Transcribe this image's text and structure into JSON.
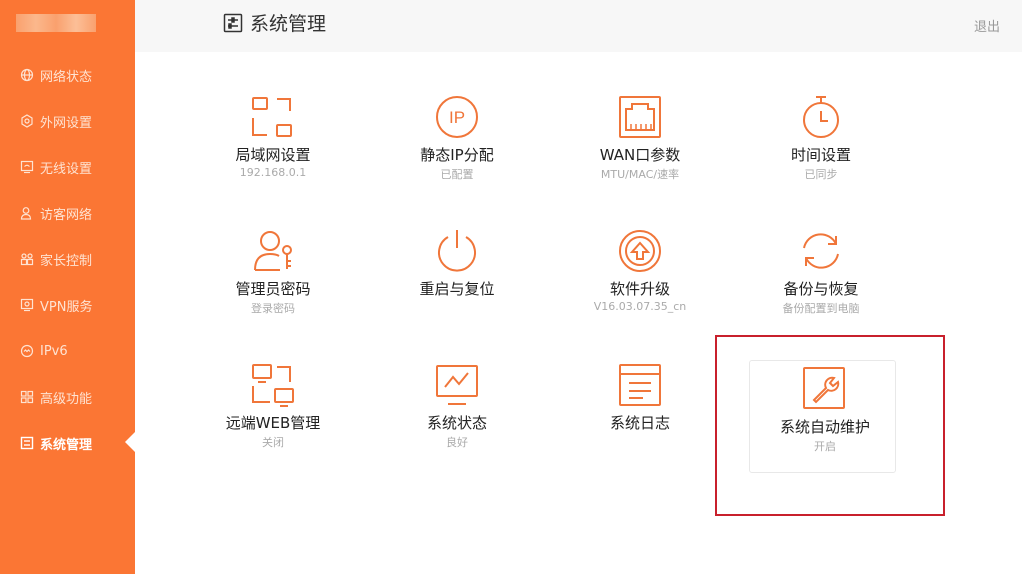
{
  "sidebar": {
    "items": [
      {
        "label": "网络状态",
        "icon": "globe-icon"
      },
      {
        "label": "外网设置",
        "icon": "gear-icon"
      },
      {
        "label": "无线设置",
        "icon": "wifi-icon"
      },
      {
        "label": "访客网络",
        "icon": "guest-icon"
      },
      {
        "label": "家长控制",
        "icon": "family-icon"
      },
      {
        "label": "VPN服务",
        "icon": "vpn-icon"
      },
      {
        "label": "IPv6",
        "icon": "ipv6-icon"
      },
      {
        "label": "高级功能",
        "icon": "grid-icon"
      },
      {
        "label": "系统管理",
        "icon": "system-icon",
        "active": true
      }
    ]
  },
  "header": {
    "title": "系统管理",
    "logout_label": "退出"
  },
  "tiles": [
    {
      "label": "局域网设置",
      "sub": "192.168.0.1",
      "icon": "lan-icon"
    },
    {
      "label": "静态IP分配",
      "sub": "已配置",
      "icon": "ip-icon",
      "icon_text": "IP"
    },
    {
      "label": "WAN口参数",
      "sub": "MTU/MAC/速率",
      "icon": "port-icon"
    },
    {
      "label": "时间设置",
      "sub": "已同步",
      "icon": "clock-icon"
    },
    {
      "label": "管理员密码",
      "sub": "登录密码",
      "icon": "admin-key-icon"
    },
    {
      "label": "重启与复位",
      "sub": "",
      "icon": "power-icon"
    },
    {
      "label": "软件升级",
      "sub": "V16.03.07.35_cn",
      "icon": "upgrade-icon"
    },
    {
      "label": "备份与恢复",
      "sub": "备份配置到电脑",
      "icon": "sync-icon"
    },
    {
      "label": "远端WEB管理",
      "sub": "关闭",
      "icon": "remote-web-icon"
    },
    {
      "label": "系统状态",
      "sub": "良好",
      "icon": "monitor-icon"
    },
    {
      "label": "系统日志",
      "sub": "",
      "icon": "log-icon"
    },
    {
      "label": "系统自动维护",
      "sub": "开启",
      "icon": "wrench-icon",
      "selected": true
    }
  ],
  "colors": {
    "accent": "#fb7634",
    "icon_orange": "#f0763a",
    "highlight": "#c8202c"
  }
}
